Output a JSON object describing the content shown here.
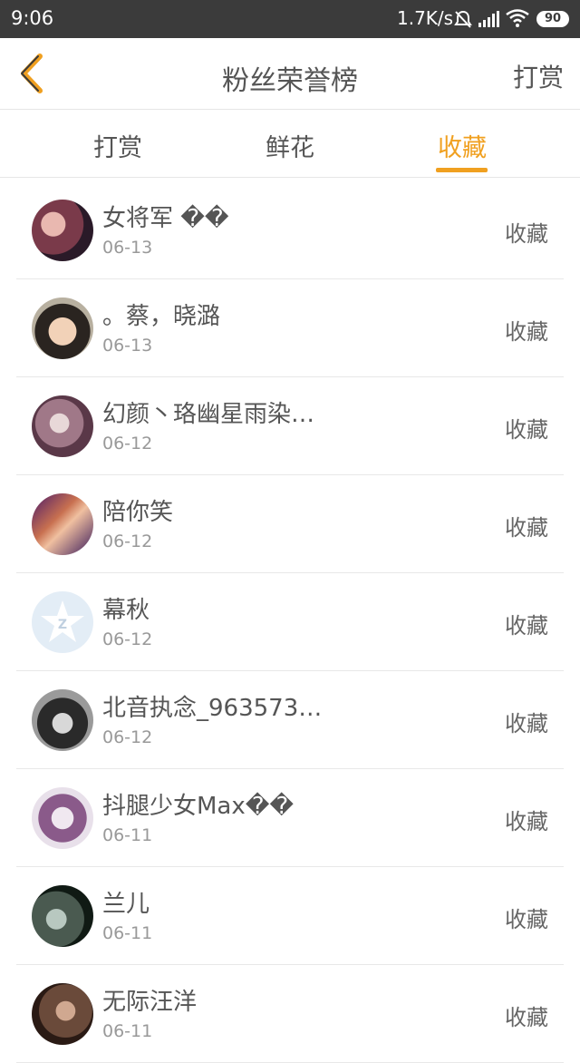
{
  "status_bar": {
    "time": "9:06",
    "net_speed": "1.7K/s",
    "battery": "90",
    "icons": [
      "mute-bell-icon",
      "signal-icon",
      "wifi-icon",
      "battery-icon"
    ]
  },
  "header": {
    "back_icon": "chevron-left-icon",
    "title": "粉丝荣誉榜",
    "action_label": "打赏"
  },
  "tabs": [
    {
      "label": "打赏"
    },
    {
      "label": "鲜花"
    },
    {
      "label": "收藏",
      "active": true
    }
  ],
  "colors": {
    "accent": "#f0a020",
    "status_bar": "#3b3b3b",
    "text": "#555555",
    "subtext": "#999999"
  },
  "items": [
    {
      "name": "女将军 ��",
      "date": "06-13",
      "type": "收藏"
    },
    {
      "name": "。蔡，晓潞",
      "date": "06-13",
      "type": "收藏"
    },
    {
      "name": "幻颜丶珞幽星雨染…",
      "date": "06-12",
      "type": "收藏"
    },
    {
      "name": "陪你笑",
      "date": "06-12",
      "type": "收藏"
    },
    {
      "name": "幕秋",
      "date": "06-12",
      "type": "收藏"
    },
    {
      "name": "北音执念_963573…",
      "date": "06-12",
      "type": "收藏"
    },
    {
      "name": "抖腿少女Max��",
      "date": "06-11",
      "type": "收藏"
    },
    {
      "name": "兰儿",
      "date": "06-11",
      "type": "收藏"
    },
    {
      "name": "无际汪洋",
      "date": "06-11",
      "type": "收藏"
    }
  ]
}
